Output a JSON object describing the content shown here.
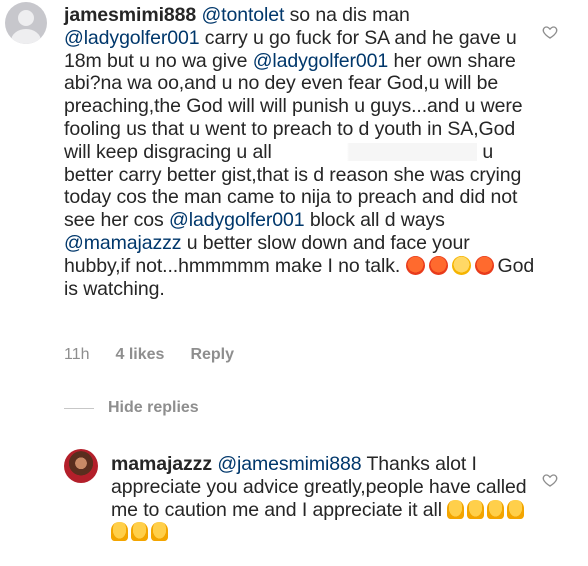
{
  "comment1": {
    "username": "jamesmimi888",
    "mention1": "@tontolet",
    "text1": " so na dis man",
    "mention2": "@ladygolfer001",
    "text2": " carry u go fuck for SA and he gave u 18m but u no wa give ",
    "mention3": "@ladygolfer001",
    "text3": " her own share abi?na wa oo,and u no dey even fear God,u will be preaching,the God will will punish u guys...and u were fooling us that u went to preach to d youth in SA,God will keep disgracing u all ",
    "text4": " u better carry better gist,that is d reason she was crying today cos the man came to nija to preach and did not see her cos ",
    "mention4": "@ladygolfer001",
    "text5": " block all d ways ",
    "mention5": "@mamajazzz",
    "text6": " u better slow down and face your hubby,if not...hmmmmm make I no talk. ",
    "text7": "God is watching.",
    "emoji_names": [
      "angry-face-icon",
      "angry-face-icon",
      "thinking-face-icon",
      "angry-face-icon"
    ],
    "time": "11h",
    "likes": "4 likes",
    "reply": "Reply",
    "colors": {
      "mention": "#00376b",
      "meta": "#8e8e8e"
    }
  },
  "hide_replies": "Hide replies",
  "comment2": {
    "username": "mamajazzz",
    "mention1": "@jamesmimi888",
    "text1": " Thanks alot I appreciate you advice greatly,people have called me to caution me and I appreciate it all ",
    "emoji_names": [
      "folded-hands-icon",
      "folded-hands-icon",
      "folded-hands-icon",
      "folded-hands-icon",
      "folded-hands-icon",
      "folded-hands-icon",
      "folded-hands-icon"
    ]
  }
}
